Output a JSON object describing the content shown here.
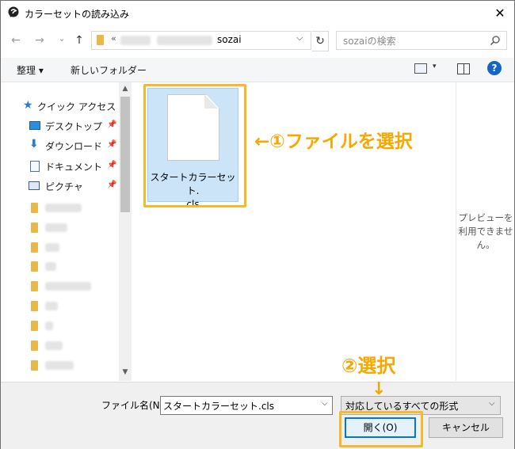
{
  "window": {
    "title": "カラーセットの読み込み",
    "close": "✕"
  },
  "nav": {
    "back": "←",
    "forward": "→",
    "up_chevron": "⌄",
    "up": "↑"
  },
  "address": {
    "prefix": "«",
    "current": "sozai",
    "dropdown": "⌵",
    "refresh": "↻"
  },
  "search": {
    "placeholder": "sozaiの検索"
  },
  "toolbar": {
    "organize": "整理 ▾",
    "new_folder": "新しいフォルダー",
    "help": "?",
    "view_dropdown": "▾"
  },
  "sidebar": {
    "quick_access": "クイック アクセス",
    "items": [
      {
        "label": "デスクトップ",
        "icon": "desktop-icon"
      },
      {
        "label": "ダウンロード",
        "icon": "download-icon"
      },
      {
        "label": "ドキュメント",
        "icon": "document-icon"
      },
      {
        "label": "ピクチャ",
        "icon": "picture-icon"
      }
    ],
    "pin": "📌"
  },
  "file": {
    "name_line1": "スタートカラーセット.",
    "name_line2": "cls"
  },
  "annotations": {
    "step1": "←①ファイルを選択",
    "step2": "②選択",
    "arrow": "↓"
  },
  "preview": {
    "text": "プレビューを利用できません。"
  },
  "footer": {
    "filename_label": "ファイル名(N):",
    "filename_value": "スタートカラーセット.cls",
    "filter_value": "対応しているすべての形式",
    "open": "開く(O)",
    "cancel": "キャンセル"
  },
  "colors": {
    "accent": "#f7b92a",
    "annotation": "#f5a800",
    "selection": "#cce4f7",
    "help": "#1466c6"
  }
}
